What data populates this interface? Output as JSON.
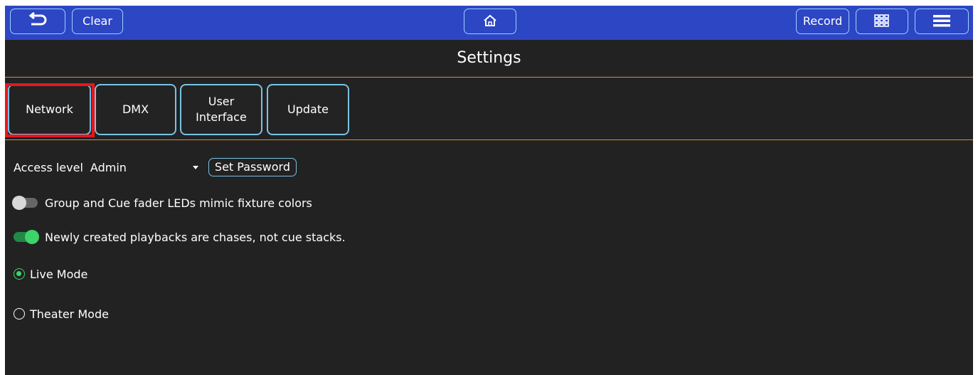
{
  "topbar": {
    "back_icon": "undo-arrow-icon",
    "clear_label": "Clear",
    "home_icon": "home-icon",
    "record_label": "Record",
    "grid_icon": "grid-icon",
    "menu_icon": "hamburger-menu-icon"
  },
  "page": {
    "title": "Settings"
  },
  "tabs": [
    {
      "label": "Network"
    },
    {
      "label": "DMX"
    },
    {
      "label": "User\nInterface"
    },
    {
      "label": "Update"
    }
  ],
  "settings": {
    "access_level_label": "Access level",
    "access_level_value": "Admin",
    "set_password_label": "Set Password",
    "fader_led_toggle": {
      "label": "Group and Cue fader LEDs mimic fixture colors",
      "on": false
    },
    "chase_toggle": {
      "label": "Newly created playbacks are chases, not cue stacks.",
      "on": true
    },
    "mode_options": [
      {
        "label": "Live Mode",
        "selected": true
      },
      {
        "label": "Theater Mode",
        "selected": false
      }
    ]
  },
  "colors": {
    "topbar": "#2d46c4",
    "background": "#222222",
    "accent_orange": "#e08a2a",
    "accent_green": "#3dd36a",
    "highlight_red": "#e8161b",
    "button_border": "#79c2e6"
  }
}
